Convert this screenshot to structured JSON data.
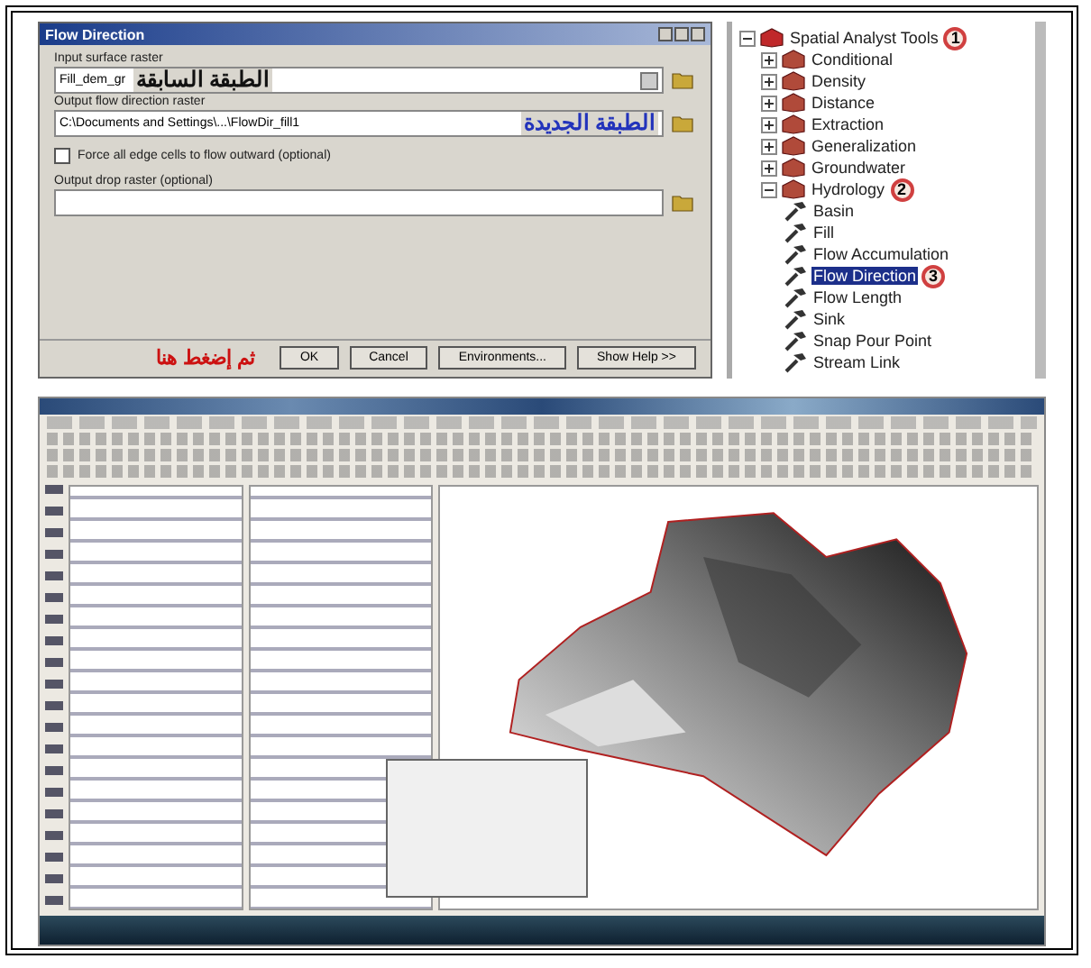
{
  "dialog": {
    "title": "Flow Direction",
    "fields": [
      {
        "kind": "dropdown",
        "label": "Input surface raster",
        "value": "Fill_dem_gr",
        "annotation": {
          "text": "الطبقة السابقة",
          "color": "#111111"
        }
      },
      {
        "kind": "path",
        "label": "Output flow direction raster",
        "value": "C:\\Documents and Settings\\...\\FlowDir_fill1",
        "annotation": {
          "text": "الطبقة الجديدة",
          "color": "#2233bb"
        }
      },
      {
        "kind": "checkbox",
        "label": "Force all edge cells to flow outward (optional)",
        "checked": false
      },
      {
        "kind": "path",
        "label": "Output drop raster (optional)"
      }
    ],
    "note": "ثم إضغط هنا",
    "buttons": [
      "OK",
      "Cancel",
      "Environments...",
      "Show Help >>"
    ]
  },
  "tree": [
    {
      "kind": "toolbox",
      "label": "Spatial Analyst Tools",
      "expanded": true,
      "callout": "1",
      "children": [
        {
          "kind": "toolset",
          "label": "Conditional",
          "expanded": false
        },
        {
          "kind": "toolset",
          "label": "Density",
          "expanded": false
        },
        {
          "kind": "toolset",
          "label": "Distance",
          "expanded": false
        },
        {
          "kind": "toolset",
          "label": "Extraction",
          "expanded": false
        },
        {
          "kind": "toolset",
          "label": "Generalization",
          "expanded": false
        },
        {
          "kind": "toolset",
          "label": "Groundwater",
          "expanded": false
        },
        {
          "kind": "toolset",
          "label": "Hydrology",
          "expanded": true,
          "callout": "2",
          "children": [
            {
              "kind": "tool",
              "label": "Basin",
              "selected": false
            },
            {
              "kind": "tool",
              "label": "Fill",
              "selected": false
            },
            {
              "kind": "tool",
              "label": "Flow Accumulation",
              "selected": false
            },
            {
              "kind": "tool",
              "label": "Flow Direction",
              "selected": true,
              "callout": "3"
            },
            {
              "kind": "tool",
              "label": "Flow Length",
              "selected": false
            },
            {
              "kind": "tool",
              "label": "Sink",
              "selected": false
            },
            {
              "kind": "tool",
              "label": "Snap Pour Point",
              "selected": false
            },
            {
              "kind": "tool",
              "label": "Stream Link",
              "selected": false
            }
          ]
        }
      ]
    }
  ]
}
